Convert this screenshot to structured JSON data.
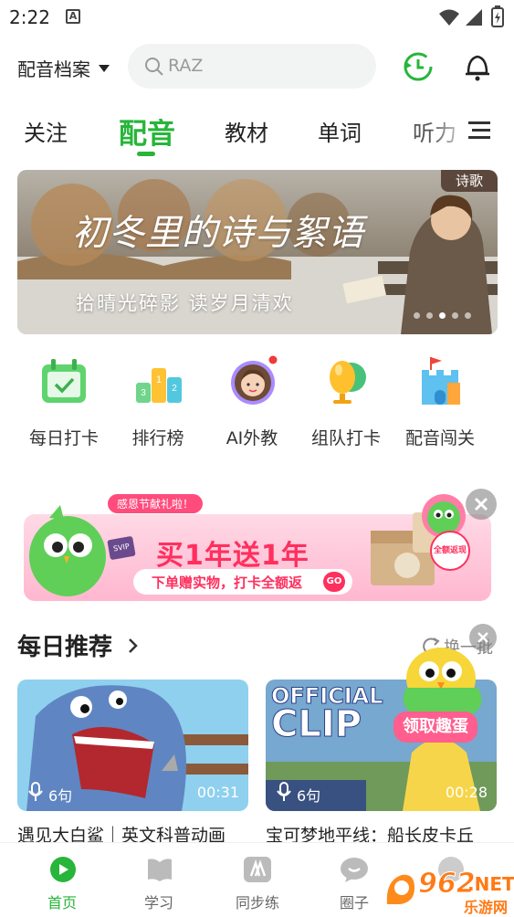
{
  "status": {
    "time": "2:22"
  },
  "topbar": {
    "profile_label": "配音档案",
    "search_placeholder": "RAZ"
  },
  "tabs": [
    "关注",
    "配音",
    "教材",
    "单词",
    "听力"
  ],
  "banner": {
    "tag": "诗歌",
    "title": "初冬里的诗与絮语",
    "subtitle": "拾晴光碎影 读岁月清欢",
    "dots": 5,
    "active_dot": 2
  },
  "quick_actions": [
    {
      "label": "每日打卡",
      "icon": "calendar-check-icon"
    },
    {
      "label": "排行榜",
      "icon": "podium-icon"
    },
    {
      "label": "AI外教",
      "icon": "ai-tutor-avatar-icon"
    },
    {
      "label": "组队打卡",
      "icon": "team-microphone-icon"
    },
    {
      "label": "配音闯关",
      "icon": "castle-flag-icon"
    }
  ],
  "promo": {
    "ribbon": "感恩节献礼啦！",
    "headline": "买1年送1年",
    "subline": "下单赠实物，打卡全额返",
    "go": "GO",
    "badge": "全额返现",
    "tag": "SVIP"
  },
  "recommend": {
    "title": "每日推荐",
    "refresh": "换一批",
    "float_label": "领取趣蛋"
  },
  "cards": [
    {
      "count": "6句",
      "duration": "00:31",
      "title": "遇见大白鲨｜英文科普动画"
    },
    {
      "count": "6句",
      "duration": "00:28",
      "title": "宝可梦地平线：船长皮卡丘",
      "overlay1": "OFFICIAL",
      "overlay2": "CLIP"
    }
  ],
  "nav": [
    {
      "label": "首页",
      "active": true
    },
    {
      "label": "学习",
      "active": false
    },
    {
      "label": "同步练",
      "active": false
    },
    {
      "label": "圈子",
      "active": false
    }
  ],
  "watermark": {
    "text1": "962",
    "text2": ".NET",
    "text3": "乐游网"
  },
  "colors": {
    "accent": "#27b53a",
    "promo_pink": "#f75a8a"
  }
}
